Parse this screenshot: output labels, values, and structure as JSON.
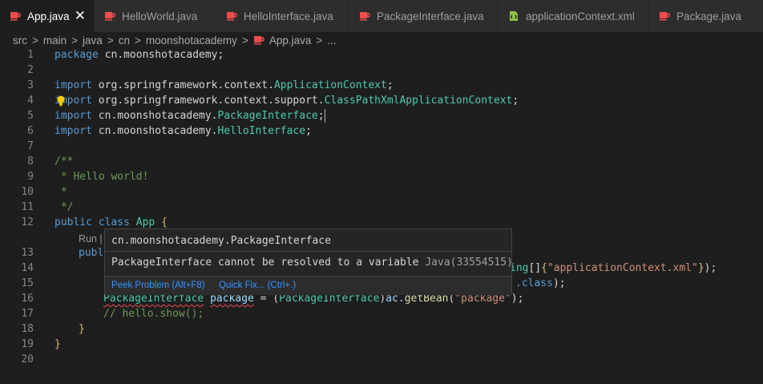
{
  "tabs": [
    {
      "label": "App.java",
      "icon": "java-file-icon",
      "active": true,
      "close": "✕"
    },
    {
      "label": "HelloWorld.java",
      "icon": "java-file-icon"
    },
    {
      "label": "HelloInterface.java",
      "icon": "java-file-icon"
    },
    {
      "label": "PackageInterface.java",
      "icon": "java-file-icon"
    },
    {
      "label": "applicationContext.xml",
      "icon": "xml-file-icon"
    },
    {
      "label": "Package.java",
      "icon": "java-file-icon"
    }
  ],
  "breadcrumb": [
    "src",
    "main",
    "java",
    "cn",
    "moonshotacademy",
    "App.java",
    "..."
  ],
  "breadcrumb_sep": ">",
  "lines": {
    "1": {
      "num": "1",
      "a": "package",
      "b": " cn.moonshotacademy;"
    },
    "2": {
      "num": "2"
    },
    "3": {
      "num": "3",
      "a": "import",
      "b": " org.springframework.context.",
      "c": "ApplicationContext",
      "d": ";"
    },
    "4": {
      "num": "4",
      "a": "import",
      "b": " org.springframework.context.support.",
      "c": "ClassPathXmlApplicationContext",
      "d": ";"
    },
    "5": {
      "num": "5",
      "a": "import",
      "b": " cn.moonshotacademy.",
      "c": "PackageInterface",
      "d": ";"
    },
    "6": {
      "num": "6",
      "a": "import",
      "b": " cn.moonshotacademy.",
      "c": "HelloInterface",
      "d": ";"
    },
    "7": {
      "num": "7"
    },
    "8": {
      "num": "8",
      "a": "/**"
    },
    "9": {
      "num": "9",
      "a": " * Hello world!"
    },
    "10": {
      "num": "10",
      "a": " *"
    },
    "11": {
      "num": "11",
      "a": " */"
    },
    "12": {
      "num": "12",
      "a": "public",
      "b": " ",
      "c": "class",
      "d": " ",
      "e": "App",
      "f": " ",
      "g": "{"
    },
    "codelens": "Run |",
    "13": {
      "num": "13",
      "a": "publ"
    },
    "14": {
      "num": "14",
      "a": "ing",
      "b": "[]",
      "c": "{",
      "d": "\"applicationContext.xml\"",
      "e": "}",
      "f": ");"
    },
    "15": {
      "num": "15",
      "a": ".class",
      "b": ");"
    },
    "16": {
      "num": "16",
      "a": "PackageInterface",
      "b": " ",
      "c": "package",
      "d": " = (",
      "e": "PackageInterface",
      "f": ")",
      "g": "ac",
      "h": ".",
      "i": "getBean",
      "j": "(",
      "k": "\"package\"",
      "l": ");"
    },
    "17": {
      "num": "17",
      "a": "// hello.show();"
    },
    "18": {
      "num": "18",
      "a": "}"
    },
    "19": {
      "num": "19",
      "a": "}"
    },
    "20": {
      "num": "20"
    }
  },
  "hover": {
    "title": "cn.moonshotacademy.PackageInterface",
    "message": "PackageInterface cannot be resolved to a variable",
    "source": "Java(33554515)",
    "peek": "Peek Problem (Alt+F8)",
    "quickfix": "Quick Fix... (Ctrl+.)"
  },
  "colors": {
    "java_icon": "#f14c4c",
    "xml_icon": "#8dc149",
    "link": "#3794ff",
    "error": "#f14c4c"
  }
}
